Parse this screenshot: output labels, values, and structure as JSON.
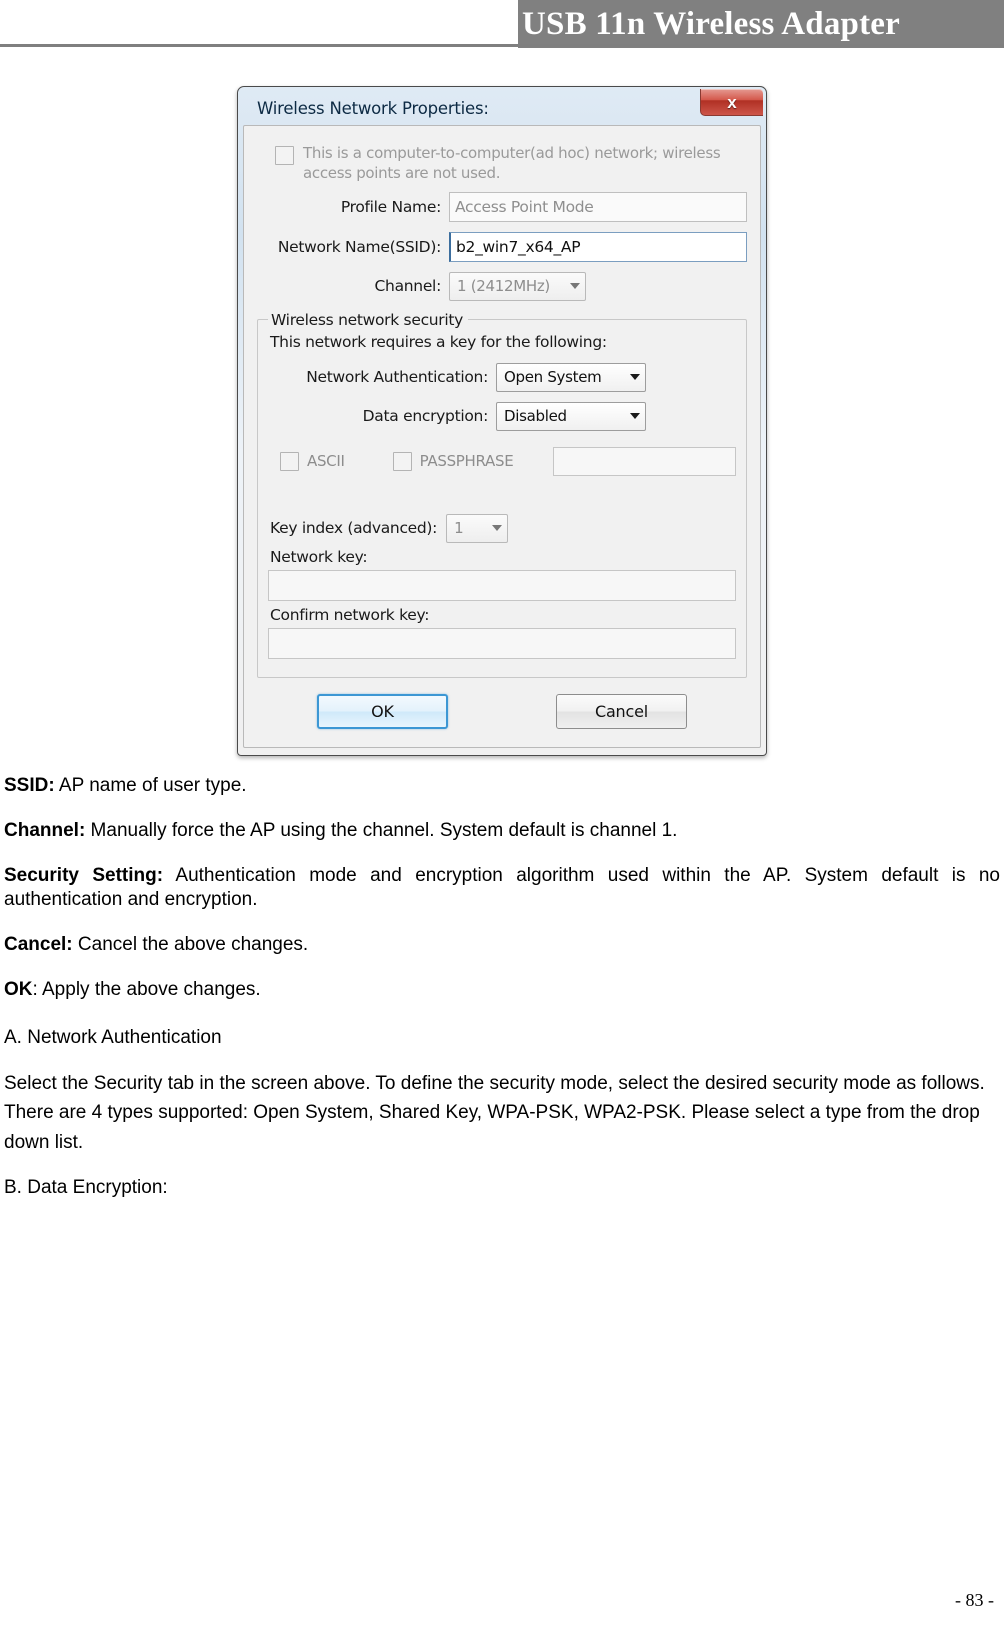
{
  "header": {
    "title": "USB 11n Wireless Adapter"
  },
  "dialog": {
    "title": "Wireless Network Properties:",
    "close_icon": "close-icon",
    "adhoc_text": "This is a computer-to-computer(ad hoc) network; wireless access points are not used.",
    "profile_name_label": "Profile Name:",
    "profile_name_value": "Access Point Mode",
    "ssid_label": "Network Name(SSID):",
    "ssid_value": "b2_win7_x64_AP",
    "channel_label": "Channel:",
    "channel_value": "1  (2412MHz)",
    "security_group_legend": "Wireless network security",
    "security_intro": "This network requires a key for the following:",
    "auth_label": "Network Authentication:",
    "auth_value": "Open System",
    "encryption_label": "Data encryption:",
    "encryption_value": "Disabled",
    "ascii_label": "ASCII",
    "passphrase_label": "PASSPHRASE",
    "key_input_value": "",
    "key_index_label": "Key index (advanced):",
    "key_index_value": "1",
    "network_key_label": "Network key:",
    "network_key_value": "",
    "confirm_key_label": "Confirm network key:",
    "confirm_key_value": "",
    "ok_label": "OK",
    "cancel_label": "Cancel"
  },
  "content": {
    "ssid_term": "SSID:",
    "ssid_desc": " AP name of user type.",
    "channel_term": "Channel:",
    "channel_desc": " Manually force the AP using the channel. System default is channel 1.",
    "security_term": "Security Setting:",
    "security_desc": " Authentication mode and encryption algorithm used within the AP. System default is no authentication and encryption.",
    "cancel_term": "Cancel:",
    "cancel_desc": " Cancel the above changes.",
    "ok_term": "OK",
    "ok_desc": ": Apply the above changes.",
    "section_a": "A. Network Authentication",
    "section_a_body": "Select the Security tab in the screen above. To define the security mode, select the desired security mode as follows. There are 4 types supported: Open System, Shared Key, WPA-PSK, WPA2-PSK. Please select a type from the drop down list.",
    "section_b": "B. Data Encryption:"
  },
  "footer": {
    "page_number": "- 83 -"
  }
}
